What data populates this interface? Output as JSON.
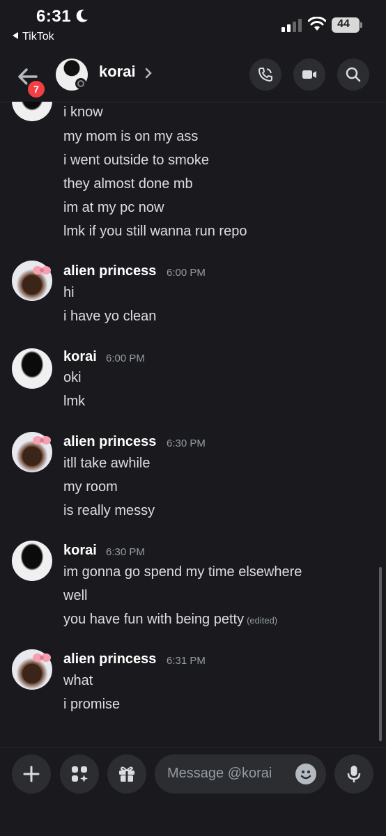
{
  "status_bar": {
    "time": "6:31",
    "back_app": "TikTok",
    "battery": "44"
  },
  "header": {
    "title": "korai",
    "badge_count": "7"
  },
  "messages": {
    "top_lines": [
      "i know",
      "my mom is on my ass",
      "i went outside to smoke",
      "they almost done mb",
      "im at my pc now",
      "lmk if you still wanna run repo"
    ],
    "groups": [
      {
        "author": "alien princess",
        "time": "6:00 PM",
        "lines": [
          "hi",
          "i have yo clean"
        ]
      },
      {
        "author": "korai",
        "time": "6:00 PM",
        "lines": [
          "oki",
          "lmk"
        ]
      },
      {
        "author": "alien princess",
        "time": "6:30 PM",
        "lines": [
          "itll take awhile",
          "my room",
          "is really messy"
        ]
      },
      {
        "author": "korai",
        "time": "6:30 PM",
        "lines": [
          "im gonna go spend my time elsewhere",
          "well",
          "you have fun with being petty"
        ],
        "edited": "(edited)"
      },
      {
        "author": "alien princess",
        "time": "6:31 PM",
        "lines": [
          "what",
          "i promise"
        ]
      }
    ]
  },
  "composer": {
    "placeholder": "Message @korai"
  }
}
